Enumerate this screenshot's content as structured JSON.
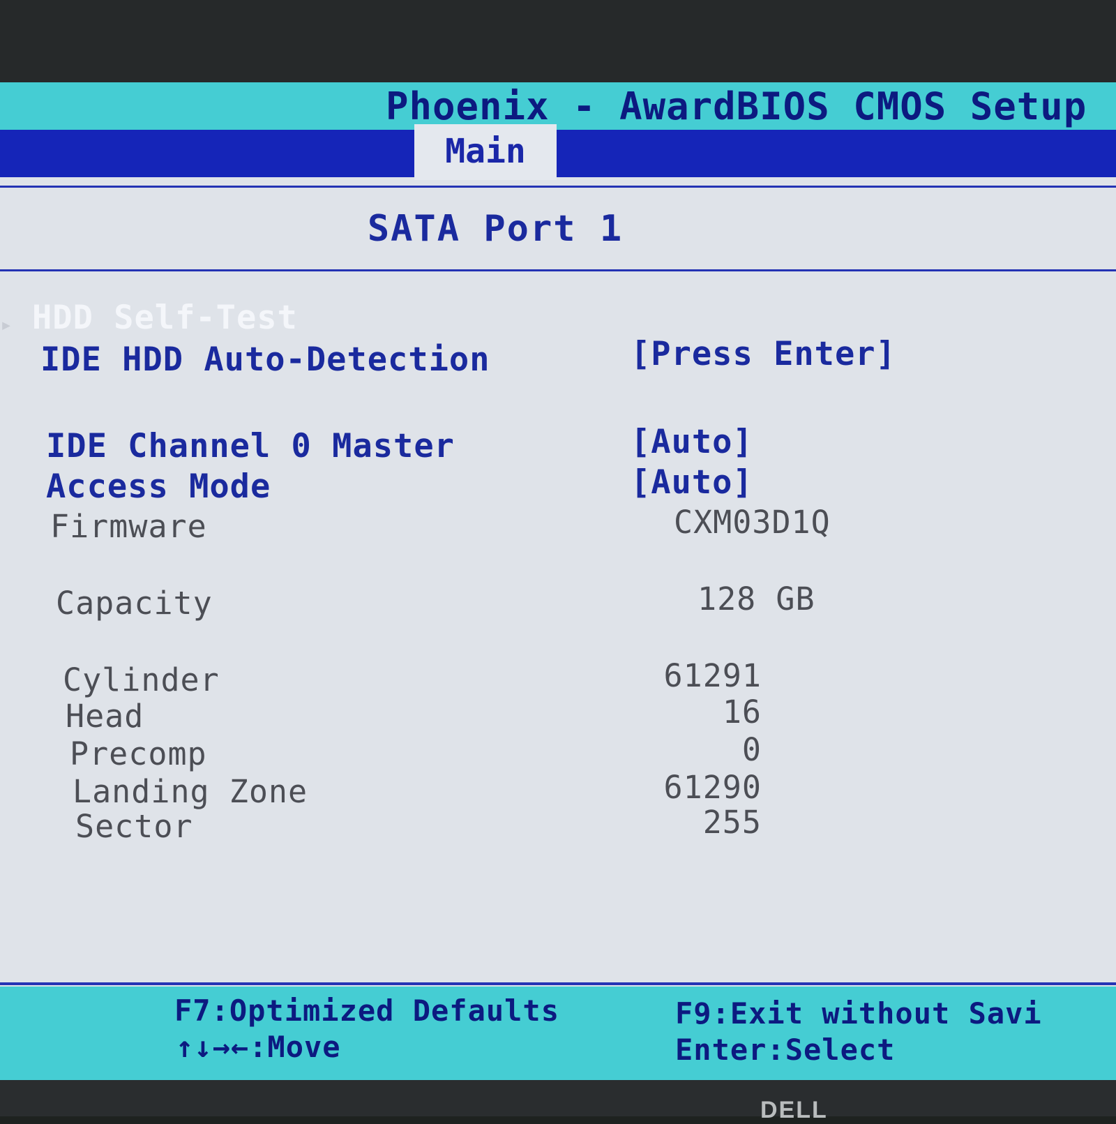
{
  "header": {
    "title": "Phoenix - AwardBIOS CMOS Setup",
    "active_tab": "Main"
  },
  "section": {
    "title": "SATA Port 1"
  },
  "menu": {
    "hdd_self_test": "HDD Self-Test",
    "auto_detect_label": "IDE HDD Auto-Detection",
    "auto_detect_value": "[Press Enter]",
    "channel_label": "IDE Channel 0 Master",
    "channel_value": "[Auto]",
    "access_label": "Access Mode",
    "access_value": "[Auto]"
  },
  "info": {
    "firmware_label": "Firmware",
    "firmware_value": "CXM03D1Q",
    "capacity_label": "Capacity",
    "capacity_value": "128 GB",
    "cylinder_label": "Cylinder",
    "cylinder_value": "61291",
    "head_label": "Head",
    "head_value": "16",
    "precomp_label": "Precomp",
    "precomp_value": "0",
    "landing_label": "Landing Zone",
    "landing_value": "61290",
    "sector_label": "Sector",
    "sector_value": "255"
  },
  "footer": {
    "f7": "F7:Optimized Defaults",
    "f9": "F9:Exit without Savi",
    "move": "↑↓→←:Move",
    "select": "Enter:Select"
  },
  "monitor": {
    "logo": "DELL"
  },
  "colors": {
    "title_bar": "#45cdd3",
    "tab_bar": "#1525b8",
    "background": "#dfe3e9",
    "accent_text": "#1a2a9e",
    "info_text": "#4c4e55"
  }
}
